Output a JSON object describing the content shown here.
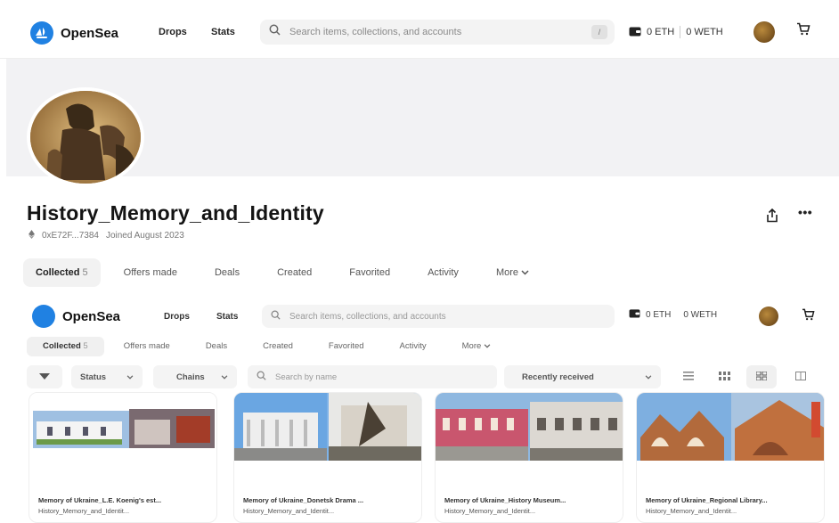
{
  "nav": {
    "brand": "OpenSea",
    "links": [
      "Drops",
      "Stats"
    ],
    "search_placeholder": "Search items, collections, and accounts",
    "search_shortcut": "/",
    "eth_balance": "0 ETH",
    "weth_balance": "0 WETH"
  },
  "profile": {
    "name": "History_Memory_and_Identity",
    "address": "0xE72F...7384",
    "joined": "Joined August 2023"
  },
  "tabs": [
    {
      "label": "Collected",
      "count": "5"
    },
    {
      "label": "Offers made"
    },
    {
      "label": "Deals"
    },
    {
      "label": "Created"
    },
    {
      "label": "Favorited"
    },
    {
      "label": "Activity"
    },
    {
      "label": "More"
    }
  ],
  "inner": {
    "brand": "OpenSea",
    "links": [
      "Drops",
      "Stats"
    ],
    "search_placeholder": "Search items, collections, and accounts",
    "eth_balance": "0 ETH",
    "weth_balance": "0 WETH",
    "tabs": [
      {
        "label": "Collected",
        "count": "5"
      },
      {
        "label": "Offers made"
      },
      {
        "label": "Deals"
      },
      {
        "label": "Created"
      },
      {
        "label": "Favorited"
      },
      {
        "label": "Activity"
      },
      {
        "label": "More"
      }
    ],
    "filters": {
      "status": "Status",
      "chains": "Chains",
      "search_placeholder": "Search by name",
      "sort": "Recently received"
    },
    "cards": [
      {
        "title": "Memory of Ukraine_L.E. Koenig's est...",
        "collection": "History_Memory_and_Identit..."
      },
      {
        "title": "Memory of Ukraine_Donetsk Drama ...",
        "collection": "History_Memory_and_Identit..."
      },
      {
        "title": "Memory of Ukraine_History Museum...",
        "collection": "History_Memory_and_Identit..."
      },
      {
        "title": "Memory of Ukraine_Regional Library...",
        "collection": "History_Memory_and_Identit..."
      }
    ]
  },
  "colors": {
    "brand_blue": "#2081e2",
    "banner": "#f2f2f4",
    "text_primary": "#121212"
  }
}
